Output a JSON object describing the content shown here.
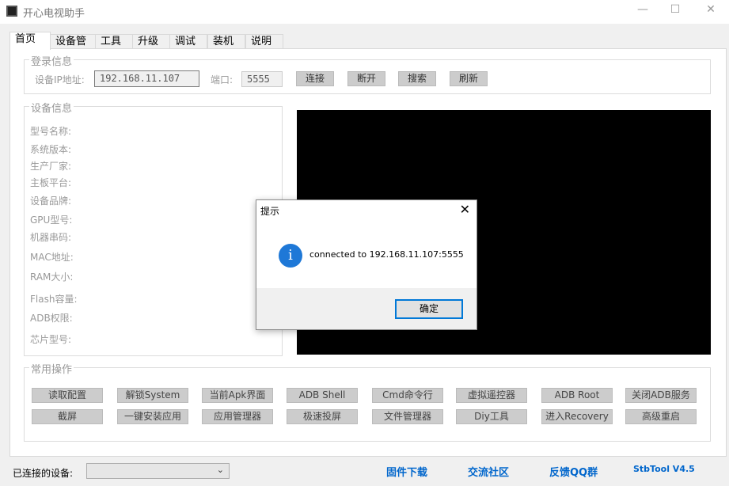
{
  "window": {
    "title": "开心电视助手"
  },
  "tabs": [
    "首页",
    "设备管理",
    "工具箱",
    "升级",
    "调试",
    "装机",
    "说明"
  ],
  "login": {
    "group_label": "登录信息",
    "ip_label": "设备IP地址:",
    "ip_value": "192.168.11.107",
    "port_label": "端口:",
    "port_value": "5555",
    "buttons": [
      "连接",
      "断开",
      "搜索",
      "刷新"
    ]
  },
  "device_info": {
    "group_label": "设备信息",
    "fields": [
      "型号名称:",
      "系统版本:",
      "生产厂家:",
      "主板平台:",
      "设备品牌:",
      "GPU型号:",
      "机器串码:",
      "MAC地址:",
      "RAM大小:",
      "Flash容量:",
      "ADB权限:",
      "芯片型号:"
    ]
  },
  "operations": {
    "group_label": "常用操作",
    "row1": [
      "读取配置",
      "解锁System",
      "当前Apk界面",
      "ADB Shell",
      "Cmd命令行",
      "虚拟遥控器",
      "ADB  Root",
      "关闭ADB服务"
    ],
    "row2": [
      "截屏",
      "一键安装应用",
      "应用管理器",
      "极速投屏",
      "文件管理器",
      "Diy工具",
      "进入Recovery",
      "高级重启"
    ]
  },
  "dialog": {
    "title": "提示",
    "message": "connected to 192.168.11.107:5555",
    "ok_label": "确定",
    "icon": "info-icon"
  },
  "footer": {
    "connected_label": "已连接的设备:",
    "selected_device": "",
    "links": [
      "固件下载",
      "交流社区",
      "反馈QQ群",
      "StbTool V4.5"
    ]
  },
  "colors": {
    "link": "#0066cc",
    "info": "#1e78d7",
    "focus": "#0078d7"
  }
}
